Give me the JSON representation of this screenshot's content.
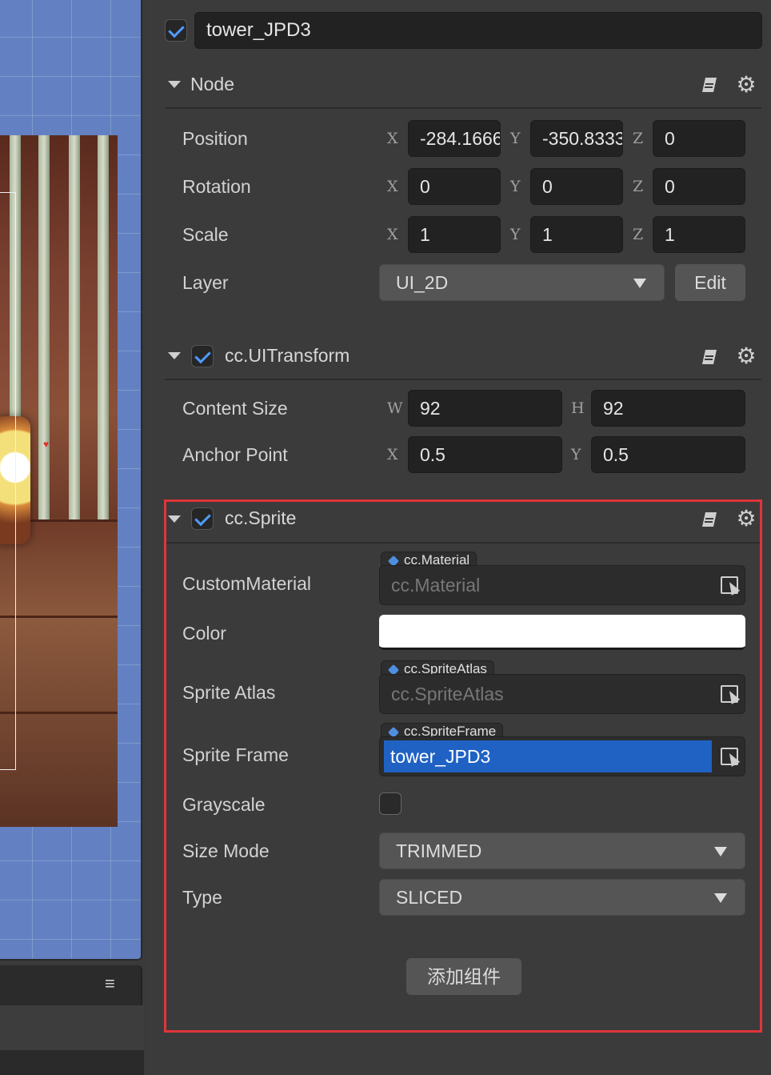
{
  "node_name": "tower_JPD3",
  "node_section": {
    "title": "Node",
    "position": {
      "label": "Position",
      "x": "-284.1666",
      "y": "-350.8333",
      "z": "0"
    },
    "rotation": {
      "label": "Rotation",
      "x": "0",
      "y": "0",
      "z": "0"
    },
    "scale": {
      "label": "Scale",
      "x": "1",
      "y": "1",
      "z": "1"
    },
    "layer": {
      "label": "Layer",
      "value": "UI_2D",
      "edit_label": "Edit"
    },
    "axes": {
      "x": "X",
      "y": "Y",
      "z": "Z"
    }
  },
  "uitransform": {
    "title": "cc.UITransform",
    "content_size": {
      "label": "Content Size",
      "w_axis": "W",
      "h_axis": "H",
      "w": "92",
      "h": "92"
    },
    "anchor_point": {
      "label": "Anchor Point",
      "x_axis": "X",
      "y_axis": "Y",
      "x": "0.5",
      "y": "0.5"
    }
  },
  "sprite": {
    "title": "cc.Sprite",
    "custom_material": {
      "label": "CustomMaterial",
      "tag": "cc.Material",
      "value": "cc.Material"
    },
    "color": {
      "label": "Color",
      "value": "#ffffff"
    },
    "sprite_atlas": {
      "label": "Sprite Atlas",
      "tag": "cc.SpriteAtlas",
      "value": "cc.SpriteAtlas"
    },
    "sprite_frame": {
      "label": "Sprite Frame",
      "tag": "cc.SpriteFrame",
      "value": "tower_JPD3"
    },
    "grayscale": {
      "label": "Grayscale",
      "checked": false
    },
    "size_mode": {
      "label": "Size Mode",
      "value": "TRIMMED"
    },
    "type": {
      "label": "Type",
      "value": "SLICED"
    }
  },
  "add_component_label": "添加组件",
  "menu_icon": "≡",
  "colors": {
    "accent": "#4f9bff",
    "selection": "#1f62c4",
    "highlight_border": "#e0343a"
  }
}
